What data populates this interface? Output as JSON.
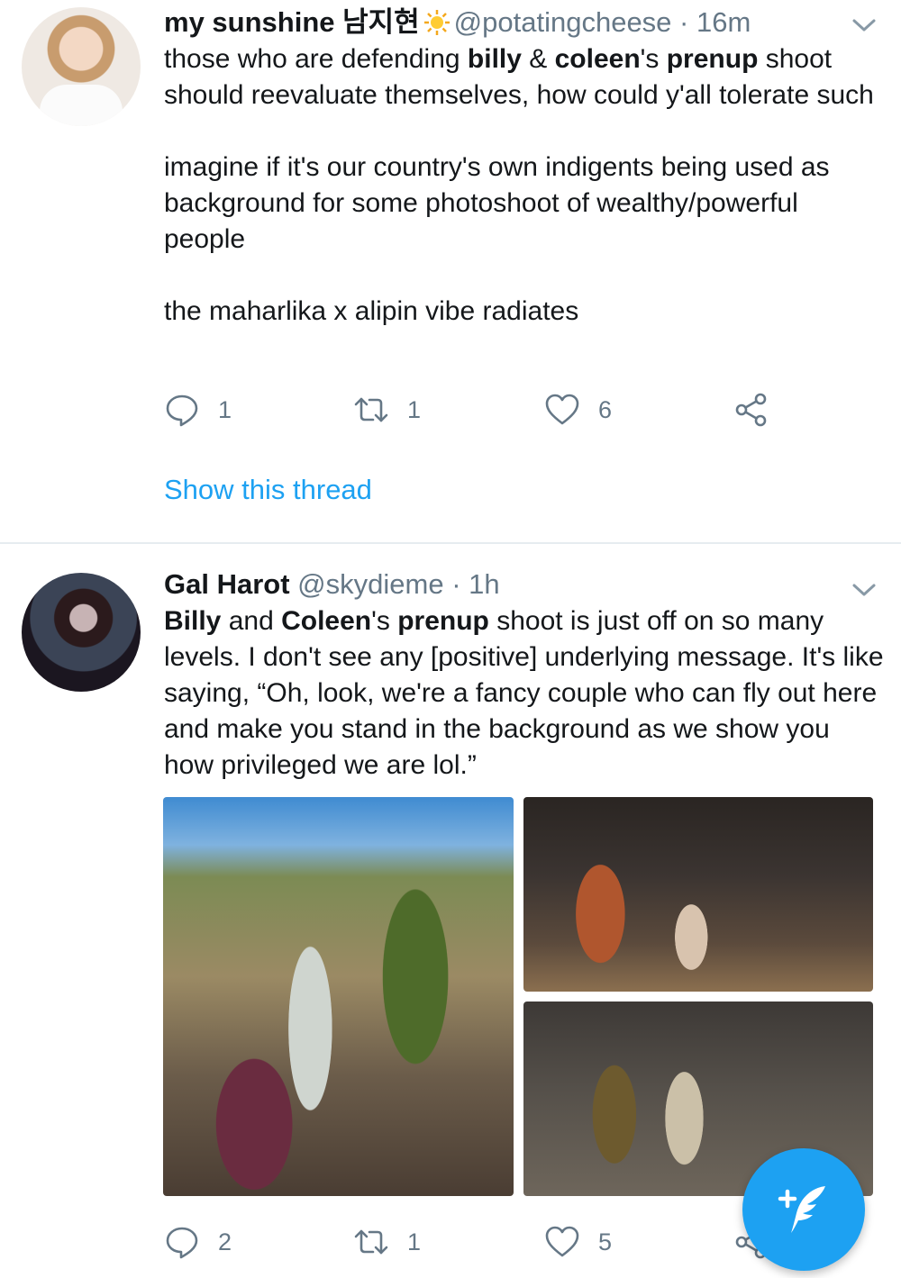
{
  "tweets": [
    {
      "display_name": "my sunshine 남지현",
      "handle": "@potatingcheese",
      "separator": "·",
      "time": "16m",
      "body": {
        "p1": {
          "t1": "those who are defending ",
          "b1": "billy",
          "t2": " & ",
          "b2": "coleen",
          "t3": "'s ",
          "b3": "prenup",
          "t4": " shoot should reevaluate themselves, how could y'all tolerate such"
        },
        "p2": "imagine if it's our country's own indigents being used as background for some photoshoot of wealthy/powerful people",
        "p3": "the maharlika x alipin vibe radiates"
      },
      "actions": {
        "replies": "1",
        "retweets": "1",
        "likes": "6"
      },
      "show_thread": "Show this thread"
    },
    {
      "display_name": "Gal Harot",
      "handle": "@skydieme",
      "separator": "·",
      "time": "1h",
      "body": {
        "b1": "Billy",
        "t1": " and ",
        "b2": "Coleen",
        "t2": "'s ",
        "b3": "prenup",
        "t3": " shoot is just off on so many levels. I don't see any [positive] underlying message. It's like saying, “Oh, look, we're a fancy couple who can fly out here and make you stand in the background as we show you how privileged we are lol.”"
      },
      "actions": {
        "replies": "2",
        "retweets": "1",
        "likes": "5"
      }
    }
  ],
  "icons": {
    "reply": "reply-icon",
    "retweet": "retweet-icon",
    "like": "heart-icon",
    "share": "share-icon",
    "caret": "chevron-down-icon",
    "sun": "sun-emoji-icon",
    "compose": "compose-tweet-icon"
  },
  "colors": {
    "accent": "#1da1f2",
    "muted": "#657786",
    "text": "#14171a",
    "divider": "#e6ecf0"
  }
}
